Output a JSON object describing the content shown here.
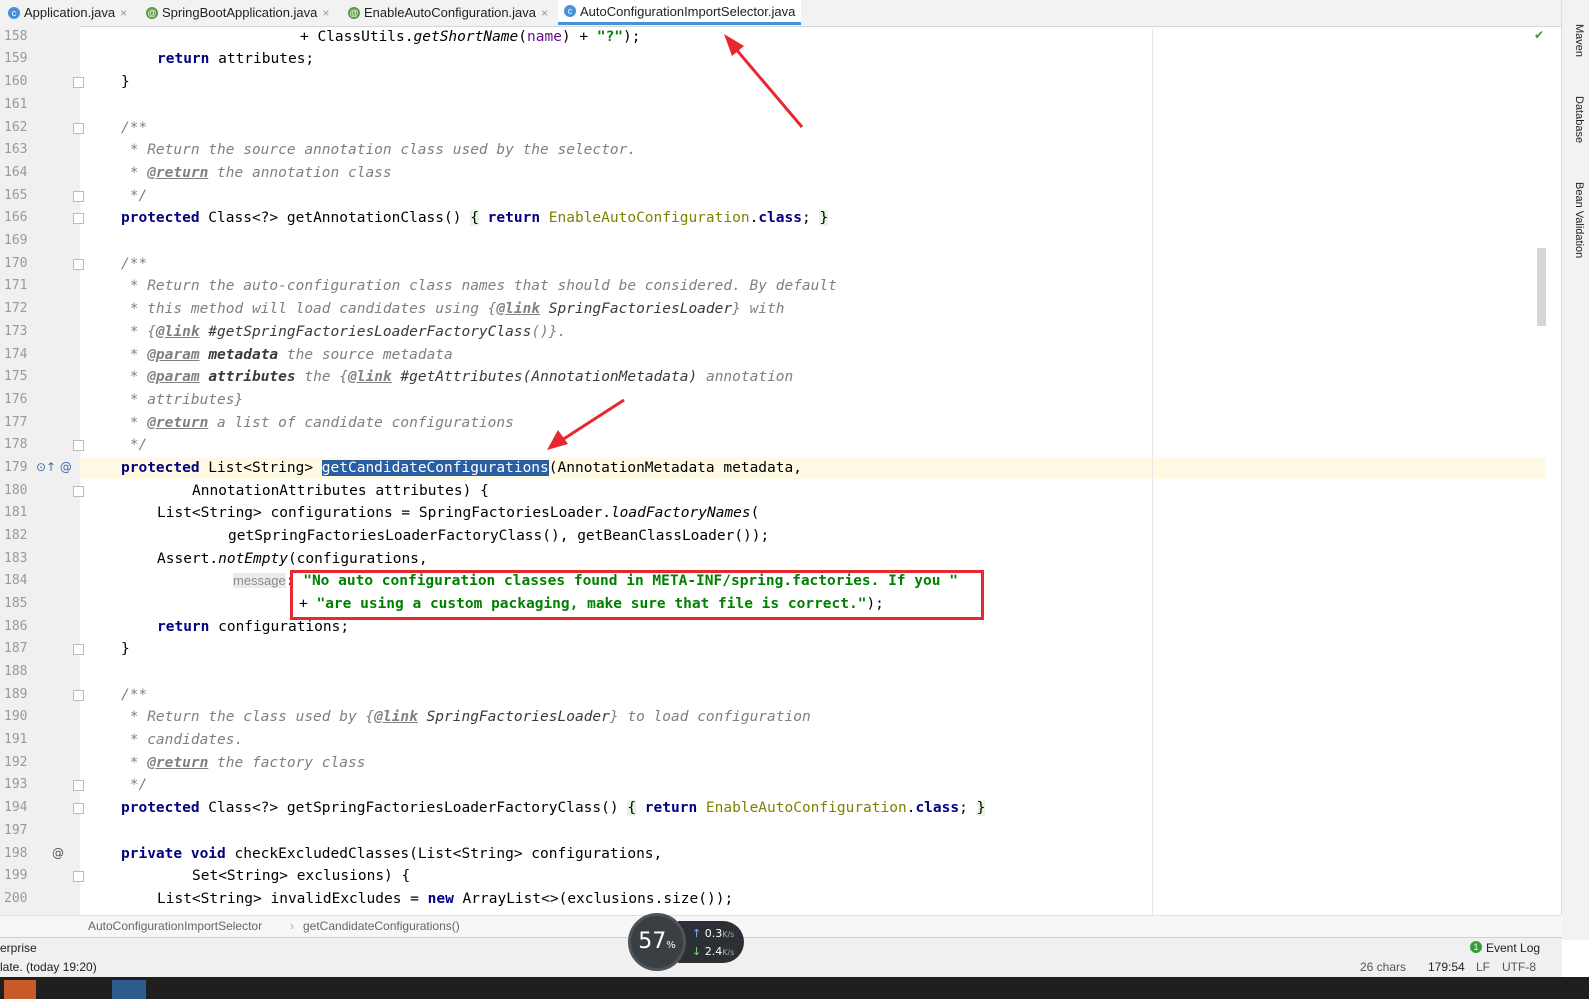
{
  "tabs": [
    {
      "label": "Application.java",
      "icon": "class-icon",
      "color": "#4a90d9"
    },
    {
      "label": "SpringBootApplication.java",
      "icon": "annotation-icon",
      "color": "#5c9a3d"
    },
    {
      "label": "EnableAutoConfiguration.java",
      "icon": "annotation-icon",
      "color": "#5c9a3d"
    },
    {
      "label": "AutoConfigurationImportSelector.java",
      "icon": "class-icon",
      "color": "#4a90d9"
    }
  ],
  "right_tools": [
    "Maven",
    "Database",
    "Bean Validation"
  ],
  "line_numbers": [
    "158",
    "159",
    "160",
    "161",
    "162",
    "163",
    "164",
    "165",
    "166",
    "169",
    "170",
    "171",
    "172",
    "173",
    "174",
    "175",
    "176",
    "177",
    "178",
    "179",
    "180",
    "181",
    "182",
    "183",
    "184",
    "185",
    "186",
    "187",
    "188",
    "189",
    "190",
    "191",
    "192",
    "193",
    "194",
    "197",
    "198",
    "199",
    "200"
  ],
  "code": {
    "l158_a": "+ ClassUtils.",
    "l158_b": "getShortName",
    "l158_c": "(",
    "l158_d": "name",
    "l158_e": ") + ",
    "l158_f": "\"?\"",
    "l158_g": ");",
    "l159_kw": "return",
    "l159_t": " attributes;",
    "l160": "}",
    "l162": "/**",
    "l163": " * Return the source annotation class used by the selector.",
    "l164_a": " * ",
    "l164_tag": "@return",
    "l164_b": " the annotation class",
    "l165": " */",
    "l166_kw": "protected",
    "l166_a": " Class<?> getAnnotationClass() ",
    "l166_b": "{",
    "l166_kw2": " return ",
    "l166_typ": "EnableAutoConfiguration",
    "l166_c": ".",
    "l166_kw3": "class",
    "l166_d": "; ",
    "l166_e": "}",
    "l170": "/**",
    "l171": " * Return the auto-configuration class names that should be considered. By default",
    "l172_a": " * this method will load candidates using {",
    "l172_tag": "@link",
    "l172_b": " SpringFactoriesLoader",
    "l172_c": "} with",
    "l173_a": " * {",
    "l173_tag": "@link",
    "l173_b": " #getSpringFactoriesLoaderFactoryClass",
    "l173_c": "()}.",
    "l174_a": " * ",
    "l174_tag": "@param",
    "l174_p": " metadata",
    "l174_b": " the source metadata",
    "l175_a": " * ",
    "l175_tag": "@param",
    "l175_p": " attributes",
    "l175_b": " the {",
    "l175_tag2": "@link",
    "l175_c": " #getAttributes",
    "l175_d": "(AnnotationMetadata)",
    "l175_e": " annotation",
    "l176": " * attributes}",
    "l177_a": " * ",
    "l177_tag": "@return",
    "l177_b": " a list of candidate configurations",
    "l178": " */",
    "l179_kw": "protected",
    "l179_a": " List<String> ",
    "l179_hl": "getCandidateConfigurations",
    "l179_b": "(AnnotationMetadata metadata,",
    "l180": "AnnotationAttributes attributes) {",
    "l181_a": "List<String> configurations = SpringFactoriesLoader.",
    "l181_b": "loadFactoryNames",
    "l181_c": "(",
    "l182": "getSpringFactoriesLoaderFactoryClass(), getBeanClassLoader());",
    "l183_a": "Assert.",
    "l183_b": "notEmpty",
    "l183_c": "(configurations,",
    "l184_hint": "message",
    "l184_a": ": ",
    "l184_str": "\"No auto configuration classes found in META-INF/spring.factories. If you \"",
    "l185_a": "+ ",
    "l185_str": "\"are using a custom packaging, make sure that file is correct.\"",
    "l185_b": ");",
    "l186_kw": "return",
    "l186_t": " configurations;",
    "l187": "}",
    "l189": "/**",
    "l190_a": " * Return the class used by {",
    "l190_tag": "@link",
    "l190_b": " SpringFactoriesLoader",
    "l190_c": "} to load configuration",
    "l191": " * candidates.",
    "l192_a": " * ",
    "l192_tag": "@return",
    "l192_b": " the factory class",
    "l193": " */",
    "l194_kw": "protected",
    "l194_a": " Class<?> getSpringFactoriesLoaderFactoryClass() ",
    "l194_b": "{",
    "l194_kw2": " return ",
    "l194_typ": "EnableAutoConfiguration",
    "l194_c": ".",
    "l194_kw3": "class",
    "l194_d": "; ",
    "l194_e": "}",
    "l198_kw": "private",
    "l198_kw2": " void",
    "l198_a": " checkExcludedClasses(List<String> configurations,",
    "l199": "Set<String> exclusions) {",
    "l200_a": "List<String> invalidExcludes = ",
    "l200_kw": "new",
    "l200_b": " ArrayList<>(exclusions.size());"
  },
  "breadcrumb": [
    "AutoConfigurationImportSelector",
    "getCandidateConfigurations()"
  ],
  "status": {
    "left_top": "erprise",
    "left_bottom": "late. (today 19:20)",
    "event_log": "Event Log",
    "chars": "26 chars",
    "position": "179:54",
    "line_sep": "LF",
    "encoding": "UTF-8"
  },
  "overlay": {
    "percent": "57",
    "percent_sign": "%",
    "up": "0.3",
    "down": "2.4",
    "unit": "K/s"
  },
  "colors": {
    "keyword": "#000080",
    "string": "#008000",
    "comment": "#808080",
    "highlight": "#2a5ea3",
    "annotation_box": "#e8282e",
    "arrow": "#e8282e"
  }
}
